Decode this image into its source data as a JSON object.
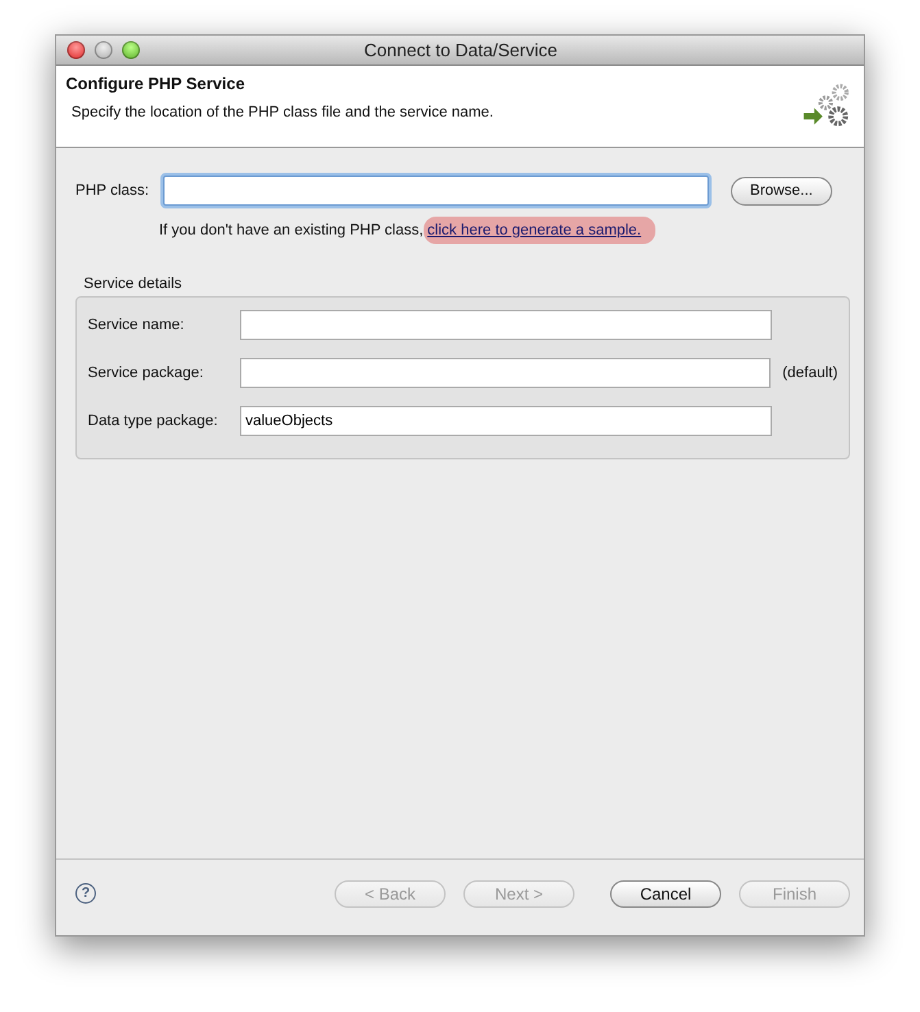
{
  "window": {
    "title": "Connect to Data/Service"
  },
  "header": {
    "title": "Configure PHP Service",
    "description": "Specify the location of the PHP class file and the service name."
  },
  "php_class": {
    "label": "PHP class:",
    "browse": "Browse..."
  },
  "hint": {
    "text": "If you don't have an existing PHP class,",
    "link": "click here to generate a sample."
  },
  "service_details": {
    "title": "Service details",
    "fields": [
      {
        "label": "Service name:"
      },
      {
        "label": "Service package:",
        "suffix": "(default)"
      },
      {
        "label": "Data type package:",
        "value": "valueObjects"
      }
    ]
  },
  "footer": {
    "help": "?",
    "buttons": [
      {
        "label": "< Back",
        "disabled": true
      },
      {
        "label": "Next >",
        "disabled": true
      },
      {
        "label": "Cancel",
        "disabled": false
      },
      {
        "label": "Finish",
        "disabled": true
      }
    ]
  }
}
